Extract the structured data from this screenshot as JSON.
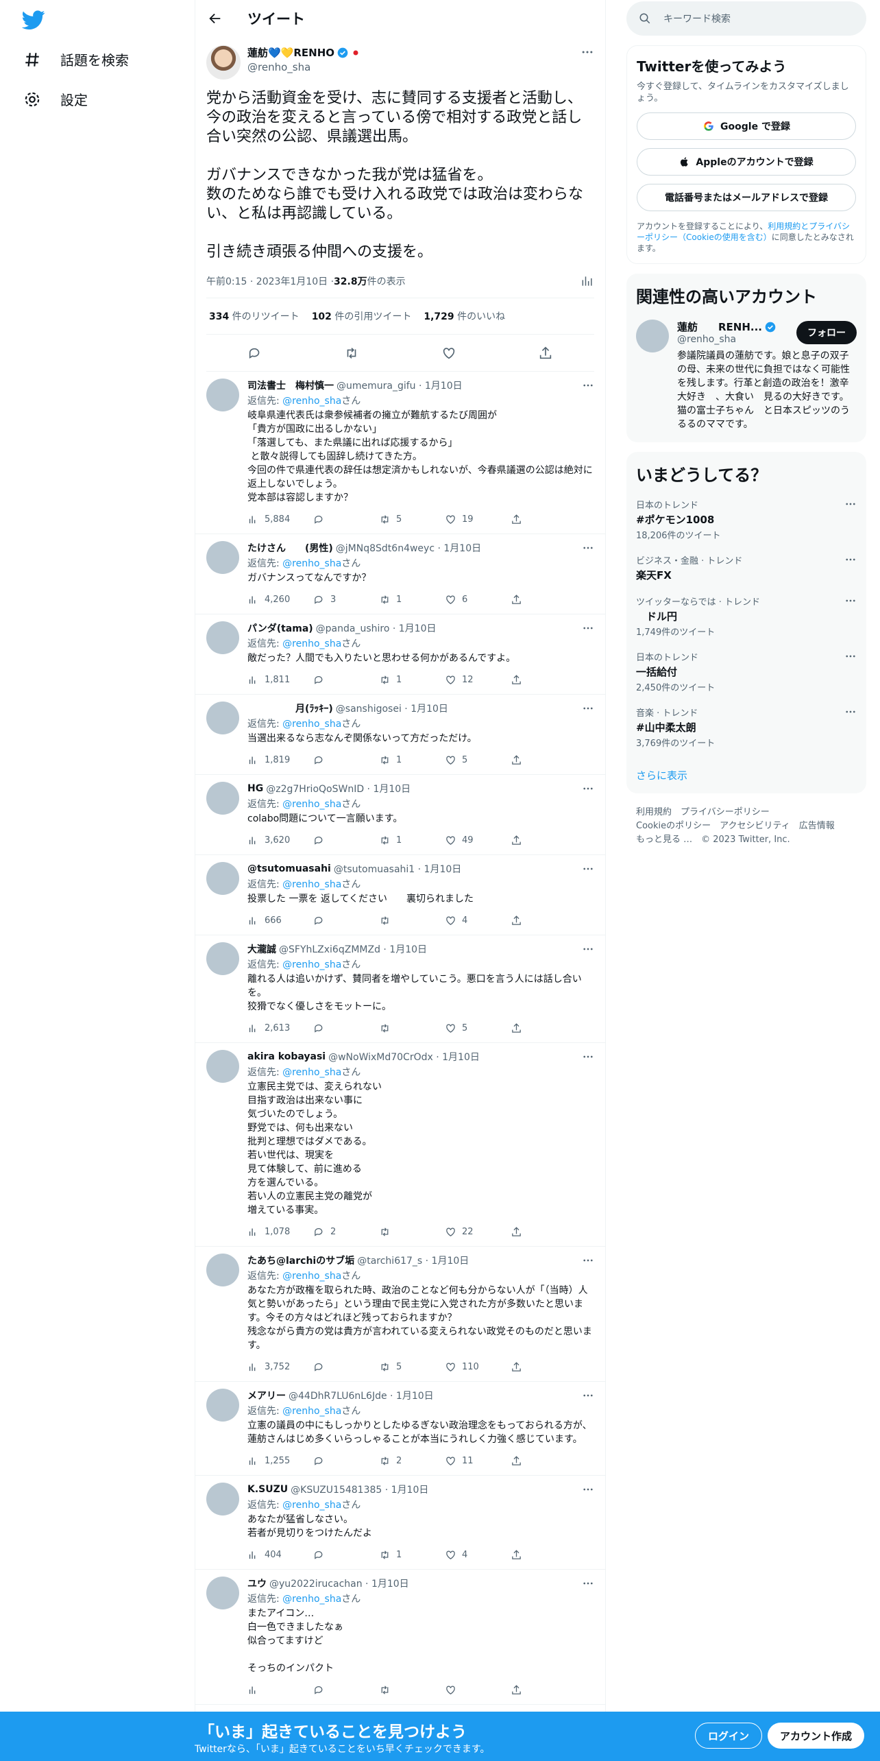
{
  "nav": {
    "explore_label": "話題を検索",
    "settings_label": "設定"
  },
  "header": {
    "title": "ツイート"
  },
  "main_tweet": {
    "name": "蓮舫💙💛RENHO",
    "handle": "@renho_sha",
    "text": "党から活動資金を受け、志に賛同する支援者と活動し、今の政治を変えると言っている傍で相対する政党と話し合い突然の公認、県議選出馬。\n\nガバナンスできなかった我が党は猛省を。\n数のためなら誰でも受け入れる政党では政治は変わらない、と私は再認識している。\n\n引き続き頑張る仲間への支援を。",
    "time": "午前0:15 · 2023年1月10日 · ",
    "views_num": "32.8万",
    "views_label": " 件の表示",
    "retweets_num": "334",
    "retweets_label": " 件のリツイート",
    "quotes_num": "102",
    "quotes_label": " 件の引用ツイート",
    "likes_num": "1,729",
    "likes_label": " 件のいいね"
  },
  "reply_to_prefix": "返信先: ",
  "reply_to_handle": "@renho_sha",
  "reply_to_suffix": "さん",
  "replies": [
    {
      "name": "司法書士　梅村慎一",
      "handle": "@umemura_gifu · 1月10日",
      "text": "岐阜県連代表氏は衆参候補者の擁立が難航するたび周囲が\n「貴方が国政に出るしかない」\n「落選しても、また県議に出れば応援するから」\n と散々説得しても固辞し続けてきた方。\n今回の件で県連代表の辞任は想定済かもしれないが、今春県議選の公認は絶対に返上しないでしょう。\n党本部は容認しますか？",
      "views": "5,884",
      "replies": "",
      "retweets": "5",
      "likes": "19"
    },
    {
      "name": "たけさん　　(男性)",
      "handle": "@jMNq8Sdt6n4weyc · 1月10日",
      "text": "ガバナンスってなんですか？",
      "views": "4,260",
      "replies": "3",
      "retweets": "1",
      "likes": "6"
    },
    {
      "name": "パンダ(tama)",
      "handle": "@panda_ushiro · 1月10日",
      "text": "敵だった？人間でも入りたいと思わせる何かがあるんですよ。",
      "views": "1,811",
      "replies": "",
      "retweets": "1",
      "likes": "12"
    },
    {
      "name": "　　　　　月(ﾗｯｷｰ)",
      "handle": "@sanshigosei · 1月10日",
      "text": "当選出来るなら志なんぞ関係ないって方だっただけ。",
      "views": "1,819",
      "replies": "",
      "retweets": "1",
      "likes": "5"
    },
    {
      "name": "HG",
      "handle": "@z2g7HrioQoSWnID · 1月10日",
      "text": "colabo問題について一言願います。",
      "views": "3,620",
      "replies": "",
      "retweets": "1",
      "likes": "49"
    },
    {
      "name": "@tsutomuasahi",
      "handle": "@tsutomuasahi1 · 1月10日",
      "text": "投票した 一票を 返してください　　裏切られました",
      "views": "666",
      "replies": "",
      "retweets": "",
      "likes": "4"
    },
    {
      "name": "大瀧誠",
      "handle": "@SFYhLZxi6qZMMZd · 1月10日",
      "text": "離れる人は追いかけず、賛同者を増やしていこう。悪口を言う人には話し合いを。\n狡猾でなく優しさをモットーに。",
      "views": "2,613",
      "replies": "",
      "retweets": "",
      "likes": "5"
    },
    {
      "name": "akira kobayasi",
      "handle": "@wNoWixMd70CrOdx · 1月10日",
      "text": "立憲民主党では、変えられない\n目指す政治は出来ない事に\n気づいたのでしょう。\n野党では、何も出来ない\n批判と理想ではダメである。\n若い世代は、現実を\n見て体験して、前に進める\n方を選んでいる。\n若い人の立憲民主党の離党が\n増えている事実。",
      "views": "1,078",
      "replies": "2",
      "retweets": "",
      "likes": "22"
    },
    {
      "name": "たあち@larchiのサブ垢",
      "handle": "@tarchi617_s · 1月10日",
      "text": "あなた方が政権を取られた時、政治のことなど何も分からない人が「（当時）人気と勢いがあったら」という理由で民主党に入党された方が多数いたと思います。今その方々はどれほど残っておられますか？\n残念ながら貴方の党は貴方が言われている変えられない政党そのものだと思います。",
      "views": "3,752",
      "replies": "",
      "retweets": "5",
      "likes": "110"
    },
    {
      "name": "メアリー",
      "handle": "@44DhR7LU6nL6Jde · 1月10日",
      "text": "立憲の議員の中にもしっかりとしたゆるぎない政治理念をもっておられる方が、蓮舫さんはじめ多くいらっしゃることが本当にうれしく力強く感じています。",
      "views": "1,255",
      "replies": "",
      "retweets": "2",
      "likes": "11"
    },
    {
      "name": "K.SUZU",
      "handle": "@KSUZU15481385 · 1月10日",
      "text": "あなたが猛省しなさい。\n若者が見切りをつけたんだよ",
      "views": "404",
      "replies": "",
      "retweets": "1",
      "likes": "4"
    },
    {
      "name": "ユウ",
      "handle": "@yu2022irucachan · 1月10日",
      "text": "またアイコン…\n白一色できましたなぁ\n似合ってますけど\n\nそっちのインパクト",
      "views": "",
      "replies": "",
      "retweets": "",
      "likes": ""
    }
  ],
  "search": {
    "placeholder": "キーワード検索"
  },
  "signup": {
    "title": "Twitterを使ってみよう",
    "subtitle": "今すぐ登録して、タイムラインをカスタマイズしましょう。",
    "google": "Google で登録",
    "apple": "Appleのアカウントで登録",
    "phone": "電話番号またはメールアドレスで登録",
    "terms_1": "アカウントを登録することにより、",
    "terms_link": "利用規約とプライバシーポリシー（Cookieの使用を含む）",
    "terms_2": "に同意したとみなされます。"
  },
  "related": {
    "title": "関連性の高いアカウント",
    "name": "蓮舫　　RENH...",
    "handle": "@renho_sha",
    "follow": "フォロー",
    "bio": "参議院議員の蓮舫です。娘と息子の双子の母、未来の世代に負担ではなく可能性を残します。行革と創造の政治を！激辛大好き　、大食い　見るの大好きです。猫の富士子ちゃん　と日本スピッツのうるるのママです。"
  },
  "trends": {
    "title": "いまどうしてる？",
    "items": [
      {
        "category": "日本のトレンド",
        "name": "#ポケモン1008",
        "count": "18,206件のツイート"
      },
      {
        "category": "ビジネス・金融 · トレンド",
        "name": "楽天FX",
        "count": ""
      },
      {
        "category": "ツイッターならでは · トレンド",
        "name": "　ドル円",
        "count": "1,749件のツイート"
      },
      {
        "category": "日本のトレンド",
        "name": "一括給付",
        "count": "2,450件のツイート"
      },
      {
        "category": "音楽 · トレンド",
        "name": "#山中柔太朗",
        "count": "3,769件のツイート"
      }
    ],
    "show_more": "さらに表示"
  },
  "footer": {
    "line1": "利用規約　プライバシーポリシー",
    "line2": "Cookieのポリシー　アクセシビリティ　広告情報",
    "line3": "もっと見る …　© 2023 Twitter, Inc."
  },
  "bottom": {
    "title": "「いま」起きていることを見つけよう",
    "subtitle": "Twitterなら、「いま」起きていることをいち早くチェックできます。",
    "login": "ログイン",
    "signup": "アカウント作成"
  },
  "colors": {
    "accent": "#1d9bf0",
    "text": "#0f1419",
    "muted": "#536471"
  }
}
